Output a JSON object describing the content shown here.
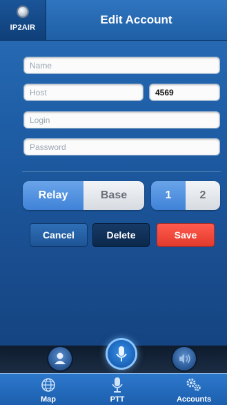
{
  "header": {
    "brand": "IP2AIR",
    "title": "Edit Account"
  },
  "form": {
    "name": {
      "placeholder": "Name",
      "value": ""
    },
    "host": {
      "placeholder": "Host",
      "value": ""
    },
    "port": {
      "placeholder": "",
      "value": "4569"
    },
    "login": {
      "placeholder": "Login",
      "value": ""
    },
    "password": {
      "placeholder": "Password",
      "value": ""
    }
  },
  "mode_toggle": {
    "options": [
      "Relay",
      "Base"
    ],
    "selected": "Relay"
  },
  "channel_toggle": {
    "options": [
      "1",
      "2"
    ],
    "selected": "1"
  },
  "actions": {
    "cancel": "Cancel",
    "delete": "Delete",
    "save": "Save"
  },
  "controls": {
    "left_icon": "person-icon",
    "center_icon": "microphone-icon",
    "right_icon": "speaker-icon"
  },
  "tabs": [
    {
      "label": "Map",
      "icon": "globe-icon"
    },
    {
      "label": "PTT",
      "icon": "microphone-icon"
    },
    {
      "label": "Accounts",
      "icon": "gears-icon"
    }
  ],
  "colors": {
    "accent_blue": "#3f82d7",
    "save_red": "#e33a2e",
    "header_blue": "#1f5fa6"
  }
}
